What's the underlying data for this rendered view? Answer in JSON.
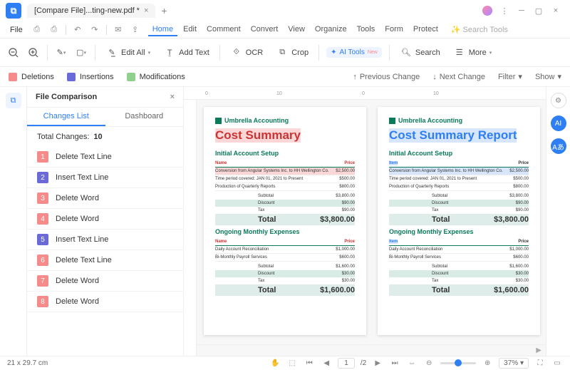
{
  "title": "[Compare  File]...ting-new.pdf *",
  "menu": {
    "file": "File",
    "tabs": [
      "Home",
      "Edit",
      "Comment",
      "Convert",
      "View",
      "Organize",
      "Tools",
      "Form",
      "Protect"
    ],
    "search_ph": "Search Tools"
  },
  "toolbar": {
    "edit_all": "Edit All",
    "add_text": "Add Text",
    "ocr": "OCR",
    "crop": "Crop",
    "ai": "AI Tools",
    "search": "Search",
    "more": "More"
  },
  "legend": {
    "del": "Deletions",
    "ins": "Insertions",
    "mod": "Modifications",
    "prev": "Previous Change",
    "next": "Next Change",
    "filter": "Filter",
    "show": "Show"
  },
  "colors": {
    "del": "#f58b8b",
    "ins": "#6a6ad8",
    "mod": "#8fd08f"
  },
  "panel": {
    "title": "File Comparison",
    "tab1": "Changes List",
    "tab2": "Dashboard",
    "total_label": "Total Changes:",
    "total": "10"
  },
  "changes": [
    {
      "n": "1",
      "t": "Delete Text Line",
      "c": "#f58b8b"
    },
    {
      "n": "2",
      "t": "Insert Text Line",
      "c": "#6a6ad8"
    },
    {
      "n": "3",
      "t": "Delete Word",
      "c": "#f58b8b"
    },
    {
      "n": "4",
      "t": "Delete Word",
      "c": "#f58b8b"
    },
    {
      "n": "5",
      "t": "Insert Text Line",
      "c": "#6a6ad8"
    },
    {
      "n": "6",
      "t": "Delete Text Line",
      "c": "#f58b8b"
    },
    {
      "n": "7",
      "t": "Delete Word",
      "c": "#f58b8b"
    },
    {
      "n": "8",
      "t": "Delete Word",
      "c": "#f58b8b"
    }
  ],
  "doc": {
    "brand": "Umbrella Accounting",
    "left_h1": "Cost Summary",
    "right_h1": "Cost Summary Report",
    "sec1": "Initial Account Setup",
    "sec2": "Ongoing Monthly Expenses",
    "col_name": "Name",
    "col_item": "Item",
    "col_price": "Price",
    "rows1": [
      {
        "l": "Conversion from Angular Systems Inc. to HH Wellington Co.",
        "p": "$2,500.00"
      },
      {
        "l": "Time period covered: JAN 01, 2021 to Present",
        "p": "$500.00"
      },
      {
        "l": "Production of Quarterly Reports",
        "p": "$800.00"
      }
    ],
    "sum1": [
      {
        "l": "Subtotal",
        "p": "$3,800.00"
      },
      {
        "l": "Discount",
        "p": "$90.00"
      },
      {
        "l": "Tax",
        "p": "$90.00"
      },
      {
        "l": "Total",
        "p": "$3,800.00"
      }
    ],
    "rows2": [
      {
        "l": "Daily Account Reconciliation",
        "p": "$1,000.00"
      },
      {
        "l": "Bi-Monthly Payroll Services",
        "p": "$600.00"
      }
    ],
    "sum2": [
      {
        "l": "Subtotal",
        "p": "$1,600.00"
      },
      {
        "l": "Discount",
        "p": "$30.00"
      },
      {
        "l": "Tax",
        "p": "$30.00"
      },
      {
        "l": "Total",
        "p": "$1,600.00"
      }
    ]
  },
  "status": {
    "dim": "21 x 29.7 cm",
    "page": "1",
    "pages": "/2",
    "zoom": "37%"
  }
}
